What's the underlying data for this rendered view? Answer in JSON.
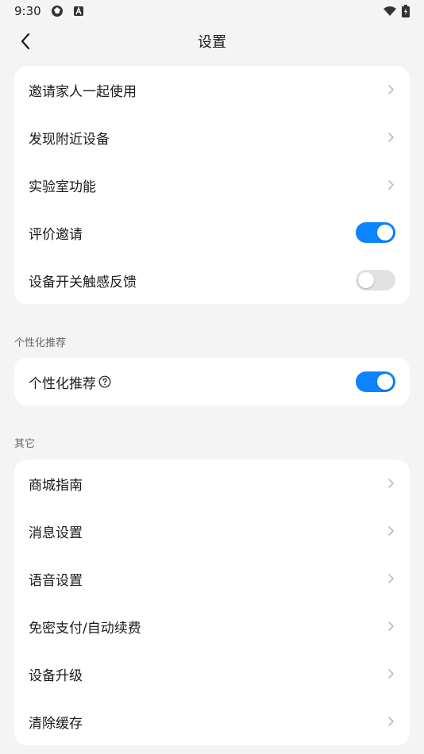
{
  "status_bar": {
    "time": "9:30"
  },
  "header": {
    "title": "设置"
  },
  "card_main": {
    "items": [
      {
        "label": "邀请家人一起使用",
        "type": "link"
      },
      {
        "label": "发现附近设备",
        "type": "link"
      },
      {
        "label": "实验室功能",
        "type": "link"
      },
      {
        "label": "评价邀请",
        "type": "toggle",
        "checked": true
      },
      {
        "label": "设备开关触感反馈",
        "type": "toggle",
        "checked": false
      }
    ]
  },
  "section_personal": {
    "title": "个性化推荐",
    "item": {
      "label": "个性化推荐",
      "type": "toggle",
      "checked": true
    }
  },
  "section_other": {
    "title": "其它",
    "items": [
      {
        "label": "商城指南",
        "type": "link"
      },
      {
        "label": "消息设置",
        "type": "link"
      },
      {
        "label": "语音设置",
        "type": "link"
      },
      {
        "label": "免密支付/自动续费",
        "type": "link"
      },
      {
        "label": "设备升级",
        "type": "link"
      },
      {
        "label": "清除缓存",
        "type": "link"
      }
    ]
  },
  "colors": {
    "accent": "#0d84ff",
    "background": "#f4f4f4",
    "card": "#ffffff"
  }
}
